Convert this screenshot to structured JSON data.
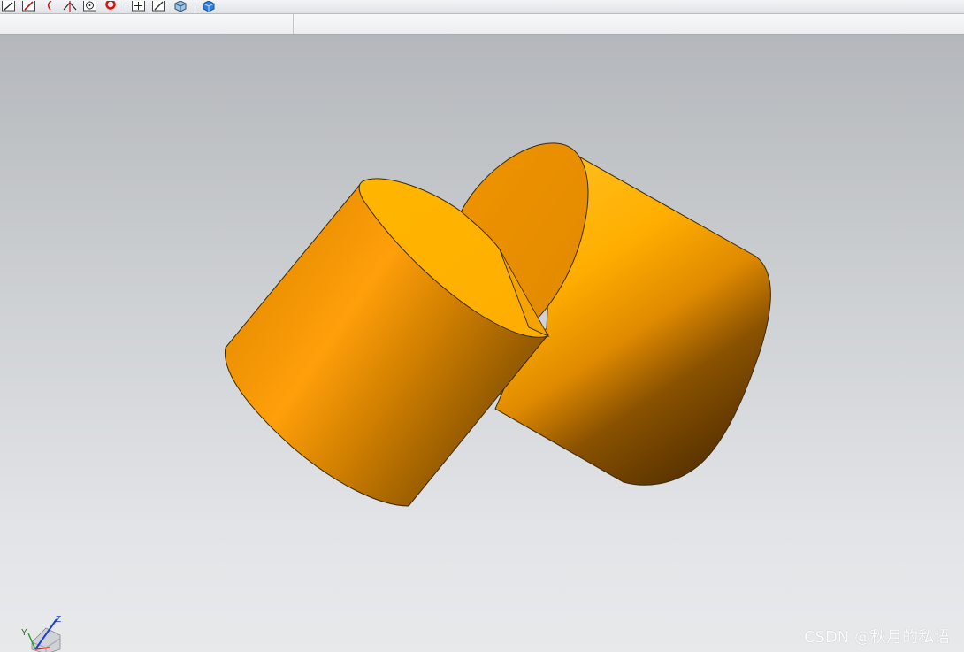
{
  "toolbar": {
    "icons": [
      "line-icon",
      "pencil-red-icon",
      "arc-icon",
      "trim-icon",
      "circle-point-icon",
      "red-ring-icon",
      "plus-icon",
      "pencil-icon",
      "cube-view-icon",
      "cube-solid-icon"
    ]
  },
  "viewport": {
    "triad": {
      "x_label": "X",
      "y_label": "Y",
      "z_label": "Z"
    },
    "watermark": "CSDN @秋月的私语"
  },
  "colors": {
    "model_light": "#ffb000",
    "model_mid": "#f5a010",
    "model_dark": "#6a3f00",
    "edge": "#3a2a10"
  }
}
